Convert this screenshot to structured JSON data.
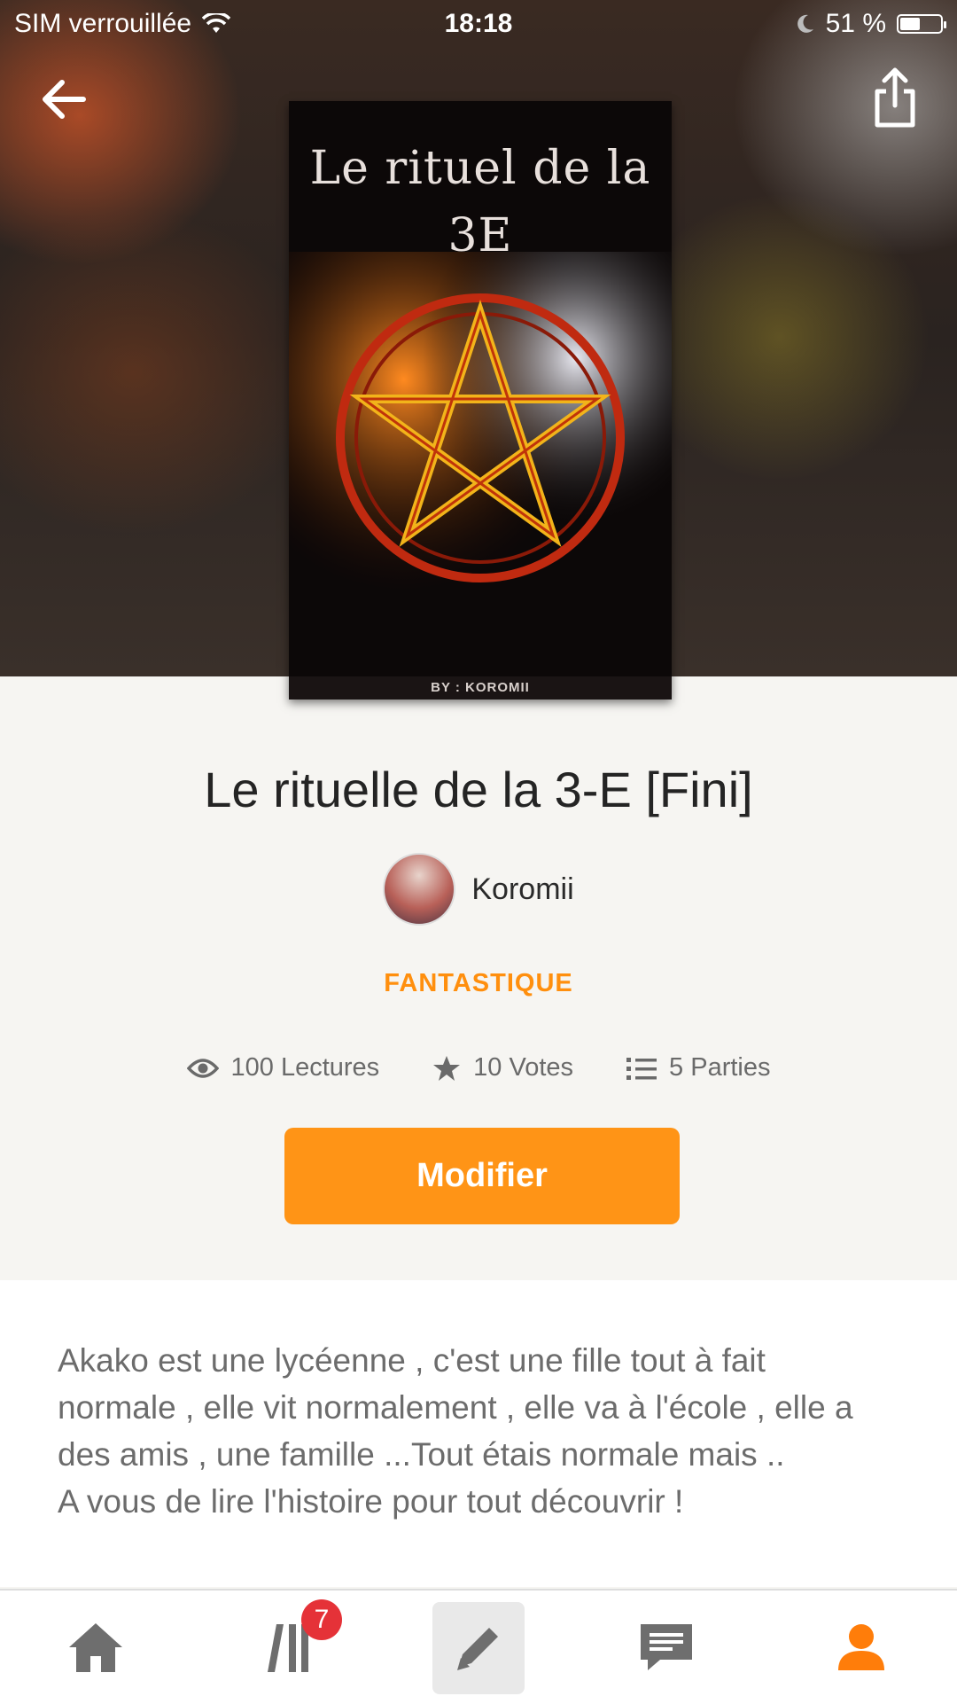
{
  "status_bar": {
    "carrier": "SIM verrouillée",
    "time": "18:18",
    "battery": "51 %",
    "battery_level": 0.51
  },
  "header": {
    "back_icon": "arrow-left-icon",
    "share_icon": "share-icon"
  },
  "cover": {
    "title_line1": "Le rituel de la",
    "title_line2": "3E",
    "byline": "BY : KOROMII"
  },
  "story": {
    "title": "Le rituelle de la 3-E [Fini]",
    "author": "Koromii",
    "genre": "FANTASTIQUE",
    "stats": {
      "reads": "100 Lectures",
      "votes": "10 Votes",
      "parts": "5 Parties"
    },
    "edit_button": "Modifier",
    "description_lines": [
      "Akako est une lycéenne , c'est une fille tout à fait",
      "normale , elle vit normalement , elle va à l'école , elle a",
      "des amis , une famille ...Tout étais normale mais ..",
      "A vous de lire l'histoire pour tout découvrir !"
    ]
  },
  "tabbar": {
    "library_badge": "7"
  },
  "colors": {
    "accent": "#ff9416",
    "genre": "#ff8f0e",
    "badge": "#e53238",
    "active_tab": "#ff7d0a"
  }
}
